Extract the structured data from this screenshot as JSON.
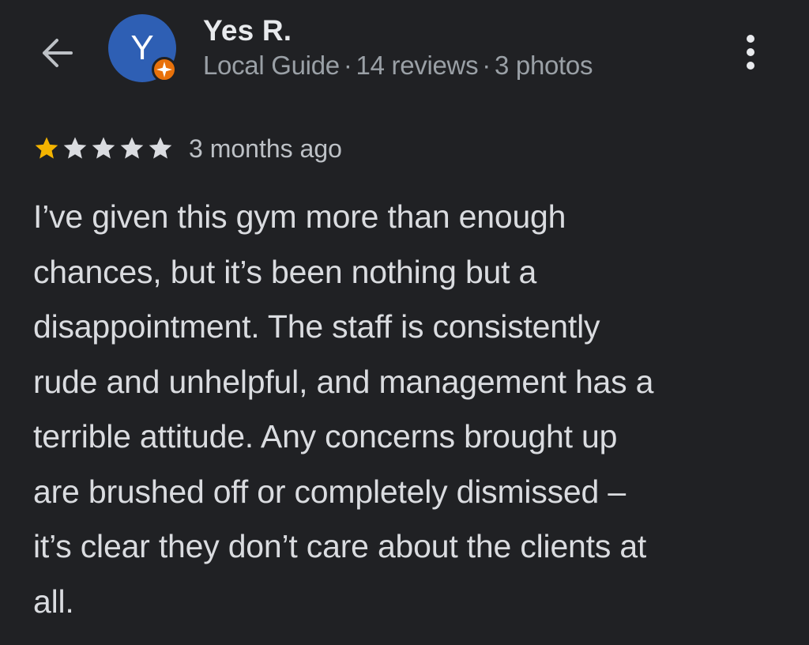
{
  "header": {
    "back_icon": "arrow-left-icon",
    "more_icon": "more-vertical-icon"
  },
  "reviewer": {
    "name": "Yes R.",
    "avatar_letter": "Y",
    "avatar_color": "#2e5fb4",
    "badge_icon": "local-guide-badge-icon",
    "badge_color": "#e8710a",
    "meta": {
      "level": "Local Guide",
      "reviews": "14 reviews",
      "photos": "3 photos"
    }
  },
  "review": {
    "rating": 1,
    "max_rating": 5,
    "star_filled_color": "#f4b400",
    "star_empty_color": "#dadce0",
    "time": "3 months ago",
    "lines": [
      "I’ve given this gym more than enough",
      "chances, but it’s been nothing but a",
      "disappointment. The staff is consistently",
      "rude and unhelpful, and management has a",
      "terrible attitude. Any concerns brought up",
      "are brushed off or completely dismissed –",
      "it’s clear they don’t care about the clients at",
      "all."
    ]
  }
}
